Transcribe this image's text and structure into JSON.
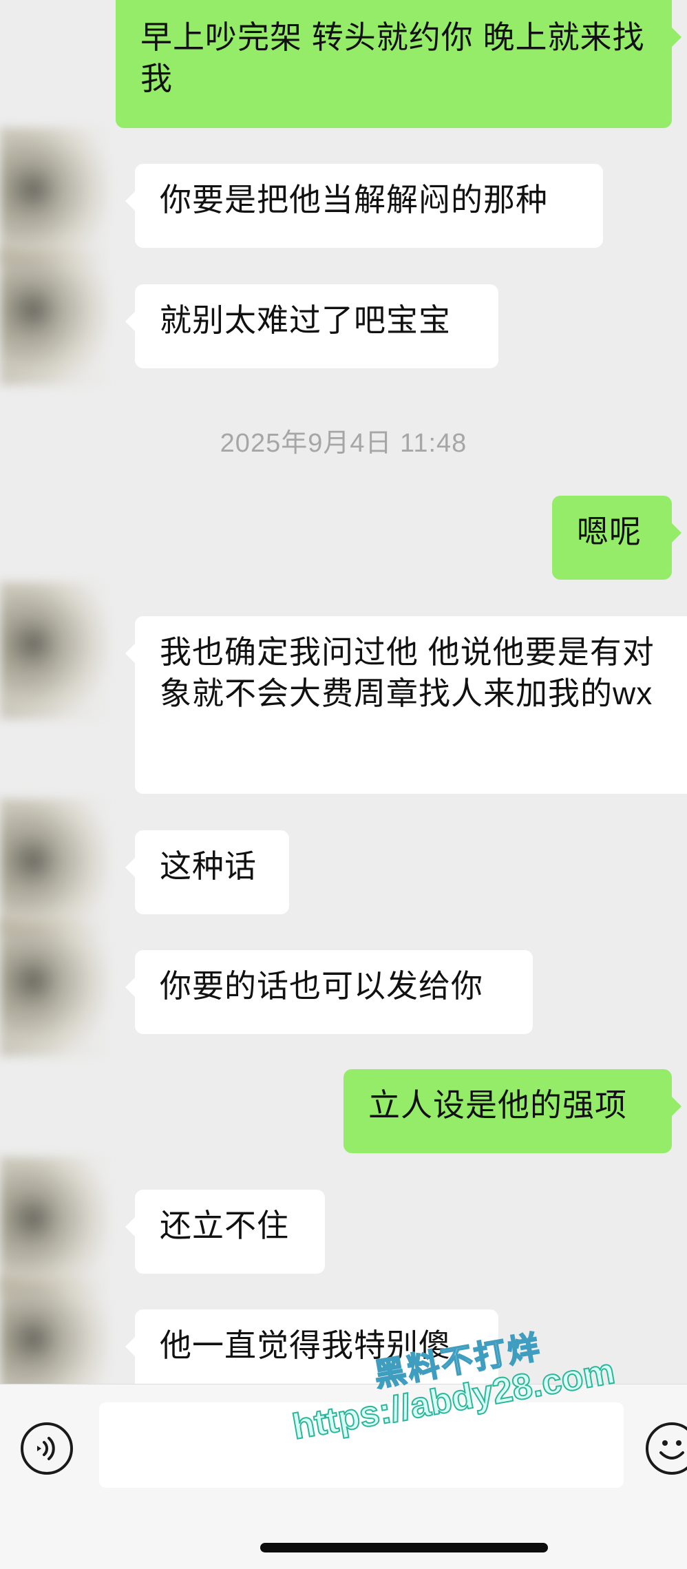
{
  "messages": [
    {
      "side": "out",
      "text": "早上吵完架 转头就约你 晚上就来找我"
    },
    {
      "side": "in",
      "text": "你要是把他当解解闷的那种"
    },
    {
      "side": "in",
      "text": "就别太难过了吧宝宝"
    },
    {
      "side": "out",
      "text": "嗯呢"
    },
    {
      "side": "in",
      "text": "我也确定我问过他  他说他要是有对象就不会大费周章找人来加我的wx"
    },
    {
      "side": "in",
      "text": "这种话"
    },
    {
      "side": "in",
      "text": "你要的话也可以发给你"
    },
    {
      "side": "out",
      "text": "立人设是他的强项"
    },
    {
      "side": "in",
      "text": "还立不住"
    },
    {
      "side": "in",
      "text": "他一直觉得我特别傻"
    }
  ],
  "timestamp": "2025年9月4日 11:48",
  "input": {
    "voice_icon": "voice-icon",
    "emoji_icon": "emoji-icon",
    "value": ""
  },
  "watermark": {
    "title": "黑料不打烊",
    "url": "https://abdy28.com"
  },
  "colors": {
    "background": "#ededed",
    "outgoing_bubble": "#95ec69",
    "incoming_bubble": "#ffffff",
    "timestamp": "#a6a6a6"
  }
}
